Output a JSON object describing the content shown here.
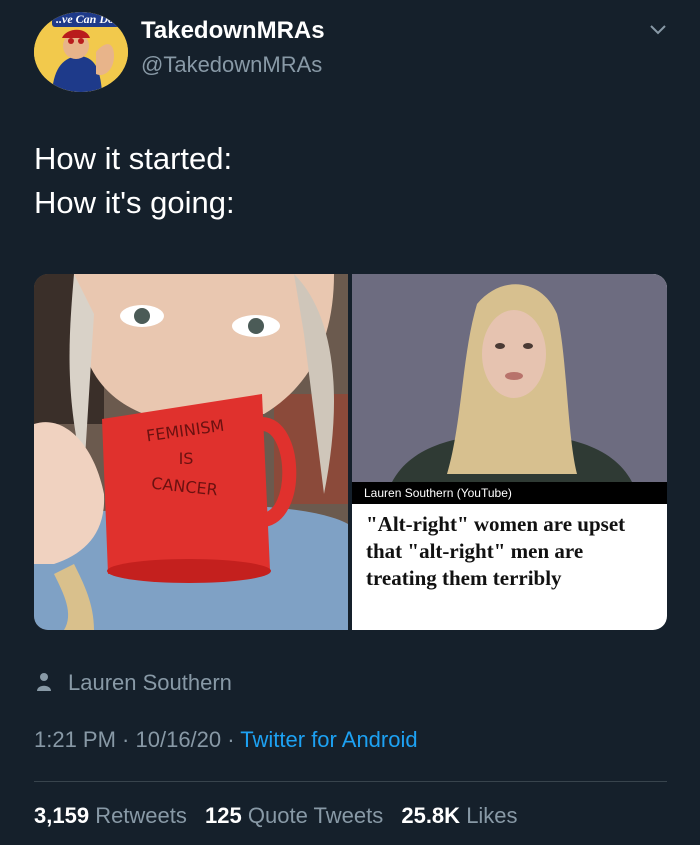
{
  "author": {
    "display_name": "TakedownMRAs",
    "handle": "@TakedownMRAs",
    "avatar_banner": "..ve Can Do I.."
  },
  "tweet": {
    "lines": [
      "How it started:",
      "How it's going:"
    ]
  },
  "media": {
    "left": {
      "mug_text": [
        "FEMINISM",
        "IS",
        "CANCER"
      ]
    },
    "right": {
      "caption": "Lauren Southern (YouTube)",
      "headline": "\"Alt-right\" women are upset that \"alt-right\" men are treating them terribly"
    }
  },
  "tagged": {
    "label": "Lauren Southern"
  },
  "meta": {
    "time": "1:21 PM",
    "sep1": " · ",
    "date": "10/16/20",
    "sep2": " · ",
    "source": "Twitter for Android"
  },
  "stats": {
    "retweets_count": "3,159",
    "retweets_label": "Retweets",
    "quotes_count": "125",
    "quotes_label": "Quote Tweets",
    "likes_count": "25.8K",
    "likes_label": "Likes"
  },
  "colors": {
    "background": "#15202b",
    "secondary_text": "#8899a6",
    "link": "#1da1f2",
    "mug_red": "#e0312d"
  }
}
